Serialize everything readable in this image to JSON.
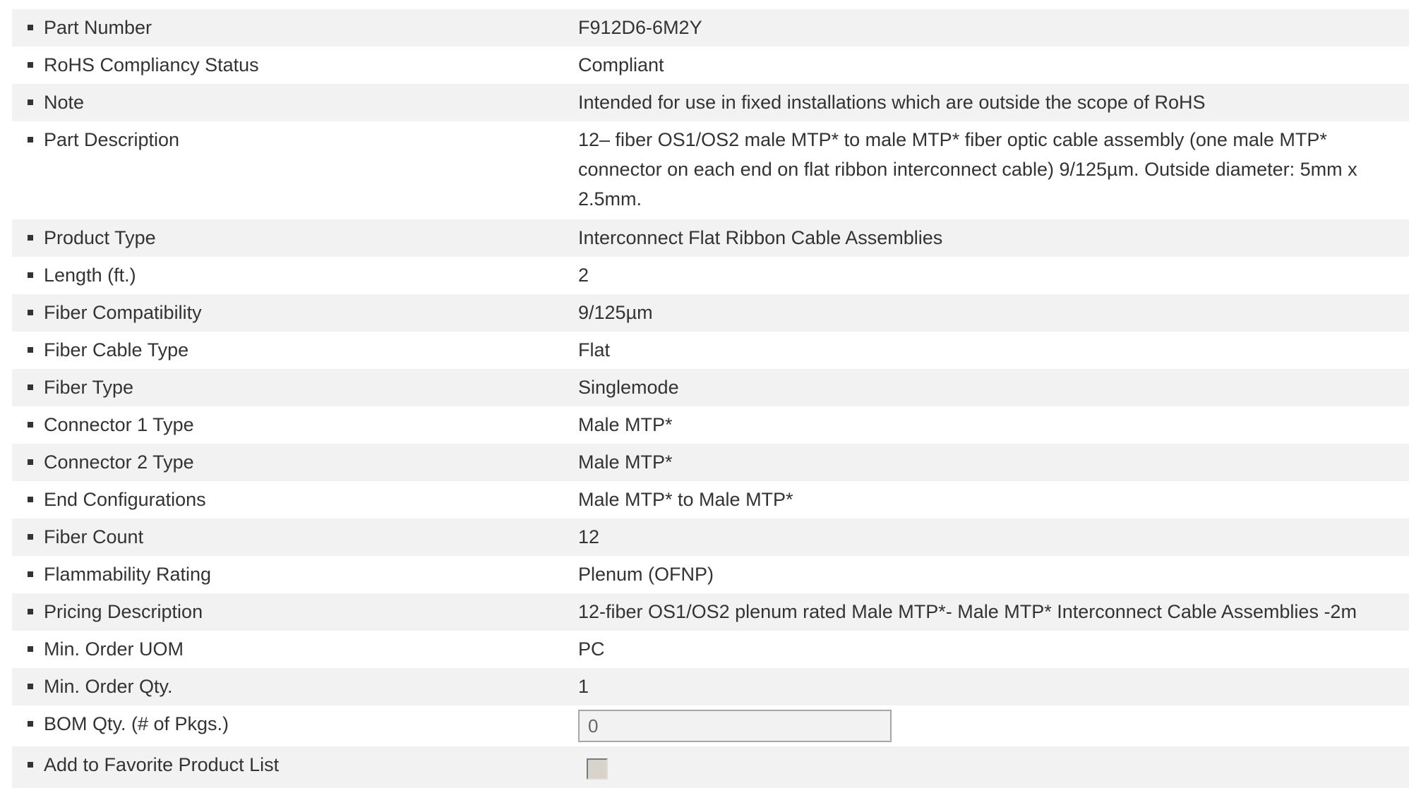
{
  "rows": [
    {
      "label": "Part Number",
      "value": "F912D6-6M2Y"
    },
    {
      "label": "RoHS Compliancy Status",
      "value": "Compliant"
    },
    {
      "label": "Note",
      "value": "Intended for use in fixed installations which are outside the scope of RoHS"
    },
    {
      "label": "Part Description",
      "value_lines": [
        "12– fiber OS1/OS2 male MTP* to male MTP* fiber optic cable assembly (one male MTP*",
        "connector on each end on flat ribbon interconnect cable) 9/125µm. Outside diameter: 5mm x",
        "2.5mm."
      ]
    },
    {
      "label": "Product Type",
      "value": "Interconnect Flat Ribbon Cable Assemblies"
    },
    {
      "label": "Length (ft.)",
      "value": "2"
    },
    {
      "label": "Fiber Compatibility",
      "value": "9/125µm"
    },
    {
      "label": "Fiber Cable Type",
      "value": "Flat"
    },
    {
      "label": "Fiber Type",
      "value": "Singlemode"
    },
    {
      "label": "Connector 1 Type",
      "value": "Male MTP*"
    },
    {
      "label": "Connector 2 Type",
      "value": "Male MTP*"
    },
    {
      "label": "End Configurations",
      "value": "Male MTP* to Male MTP*"
    },
    {
      "label": "Fiber Count",
      "value": "12"
    },
    {
      "label": "Flammability Rating",
      "value": "Plenum (OFNP)"
    },
    {
      "label": "Pricing Description",
      "value": "12-fiber OS1/OS2 plenum rated Male MTP*- Male MTP* Interconnect Cable Assemblies -2m"
    },
    {
      "label": "Min. Order UOM",
      "value": "PC"
    },
    {
      "label": "Min. Order Qty.",
      "value": "1"
    }
  ],
  "bom": {
    "label": "BOM Qty. (# of Pkgs.)",
    "value": "0"
  },
  "favorite": {
    "label": "Add to Favorite Product List",
    "checked": false
  }
}
